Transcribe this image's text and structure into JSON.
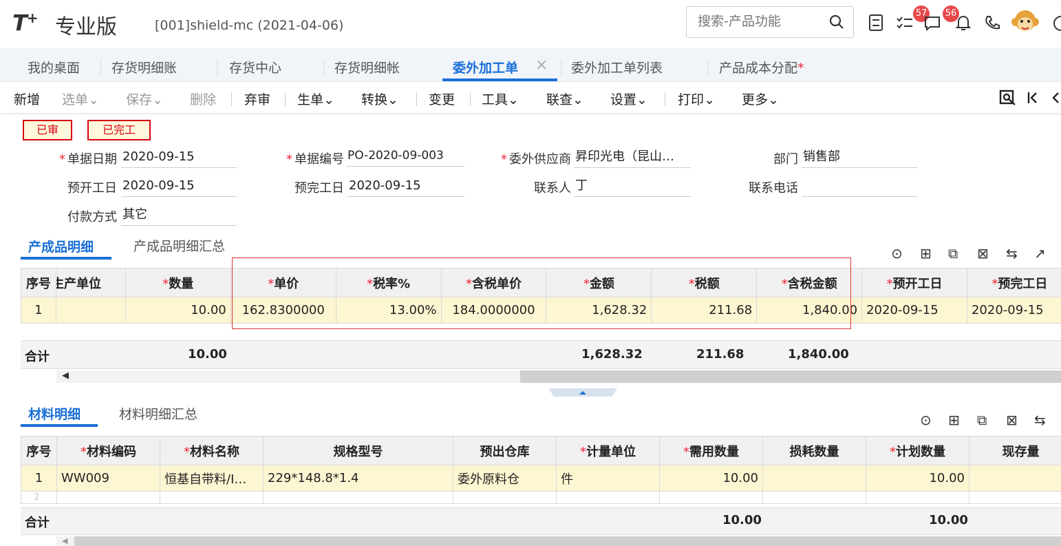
{
  "header": {
    "logo": "T",
    "logo_plus": "+",
    "edition": "专业版",
    "company": "[001]shield-mc   (2021-04-06)",
    "search_placeholder": "搜索-产品功能",
    "badge_tasks": "57",
    "badge_messages": "56"
  },
  "tabs": [
    {
      "label": "我的桌面"
    },
    {
      "label": "存货明细账"
    },
    {
      "label": "存货中心"
    },
    {
      "label": "存货明细帐"
    },
    {
      "label": "委外加工单"
    },
    {
      "label": "委外加工单列表"
    },
    {
      "label": "产品成本分配"
    }
  ],
  "tab_close": "×",
  "tab_modified_mark": "*",
  "toolbar": {
    "add": "新增",
    "select": "选单",
    "save": "保存",
    "delete": "删除",
    "unaudit": "弃审",
    "generate": "生单",
    "convert": "转换",
    "change": "变更",
    "tools": "工具",
    "query": "联查",
    "settings": "设置",
    "print": "打印",
    "more": "更多",
    "dropdown_arrow": "⌄"
  },
  "status": {
    "audited": "已审",
    "completed": "已完工"
  },
  "form": {
    "doc_date_label": "单据日期",
    "doc_date": "2020-09-15",
    "doc_no_label": "单据编号",
    "doc_no": "PO-2020-09-003",
    "supplier_label": "委外供应商",
    "supplier": "昇印光电（昆山…",
    "dept_label": "部门",
    "dept": "销售部",
    "start_label": "预开工日",
    "start": "2020-09-15",
    "finish_label": "预完工日",
    "finish": "2020-09-15",
    "contact_label": "联系人",
    "contact": "丁",
    "phone_label": "联系电话",
    "phone": "",
    "payment_label": "付款方式",
    "payment": "其它",
    "required_mark": "*"
  },
  "product_section": {
    "tab_detail": "产成品明细",
    "tab_summary": "产成品明细汇总",
    "columns": [
      "序号",
      "生产单位",
      "数量",
      "单价",
      "税率%",
      "含税单价",
      "金额",
      "税额",
      "含税金额",
      "预开工日",
      "预完工日"
    ],
    "row": [
      "1",
      "",
      "10.00",
      "162.8300000",
      "13.00%",
      "184.0000000",
      "1,628.32",
      "211.68",
      "1,840.00",
      "2020-09-15",
      "2020-09-15"
    ],
    "total_label": "合计",
    "total_qty": "10.00",
    "total_amount": "1,628.32",
    "total_tax": "211.68",
    "total_amount_tax": "1,840.00"
  },
  "material_section": {
    "tab_detail": "材料明细",
    "tab_summary": "材料明细汇总",
    "columns": [
      "序号",
      "材料编码",
      "材料名称",
      "规格型号",
      "预出仓库",
      "计量单位",
      "需用数量",
      "损耗数量",
      "计划数量",
      "现存量"
    ],
    "row": [
      "1",
      "WW009",
      "恒基自带料/I…",
      "229*148.8*1.4",
      "委外原料仓",
      "件",
      "10.00",
      "",
      "10.00",
      ""
    ],
    "row2_index": "2",
    "total_label": "合计",
    "total_need": "10.00",
    "total_plan": "10.00"
  },
  "colors": {
    "accent": "#1a6fd8",
    "stamp": "#d7000f",
    "row_highlight": "#fdf6d2",
    "badge": "#e8474b"
  }
}
